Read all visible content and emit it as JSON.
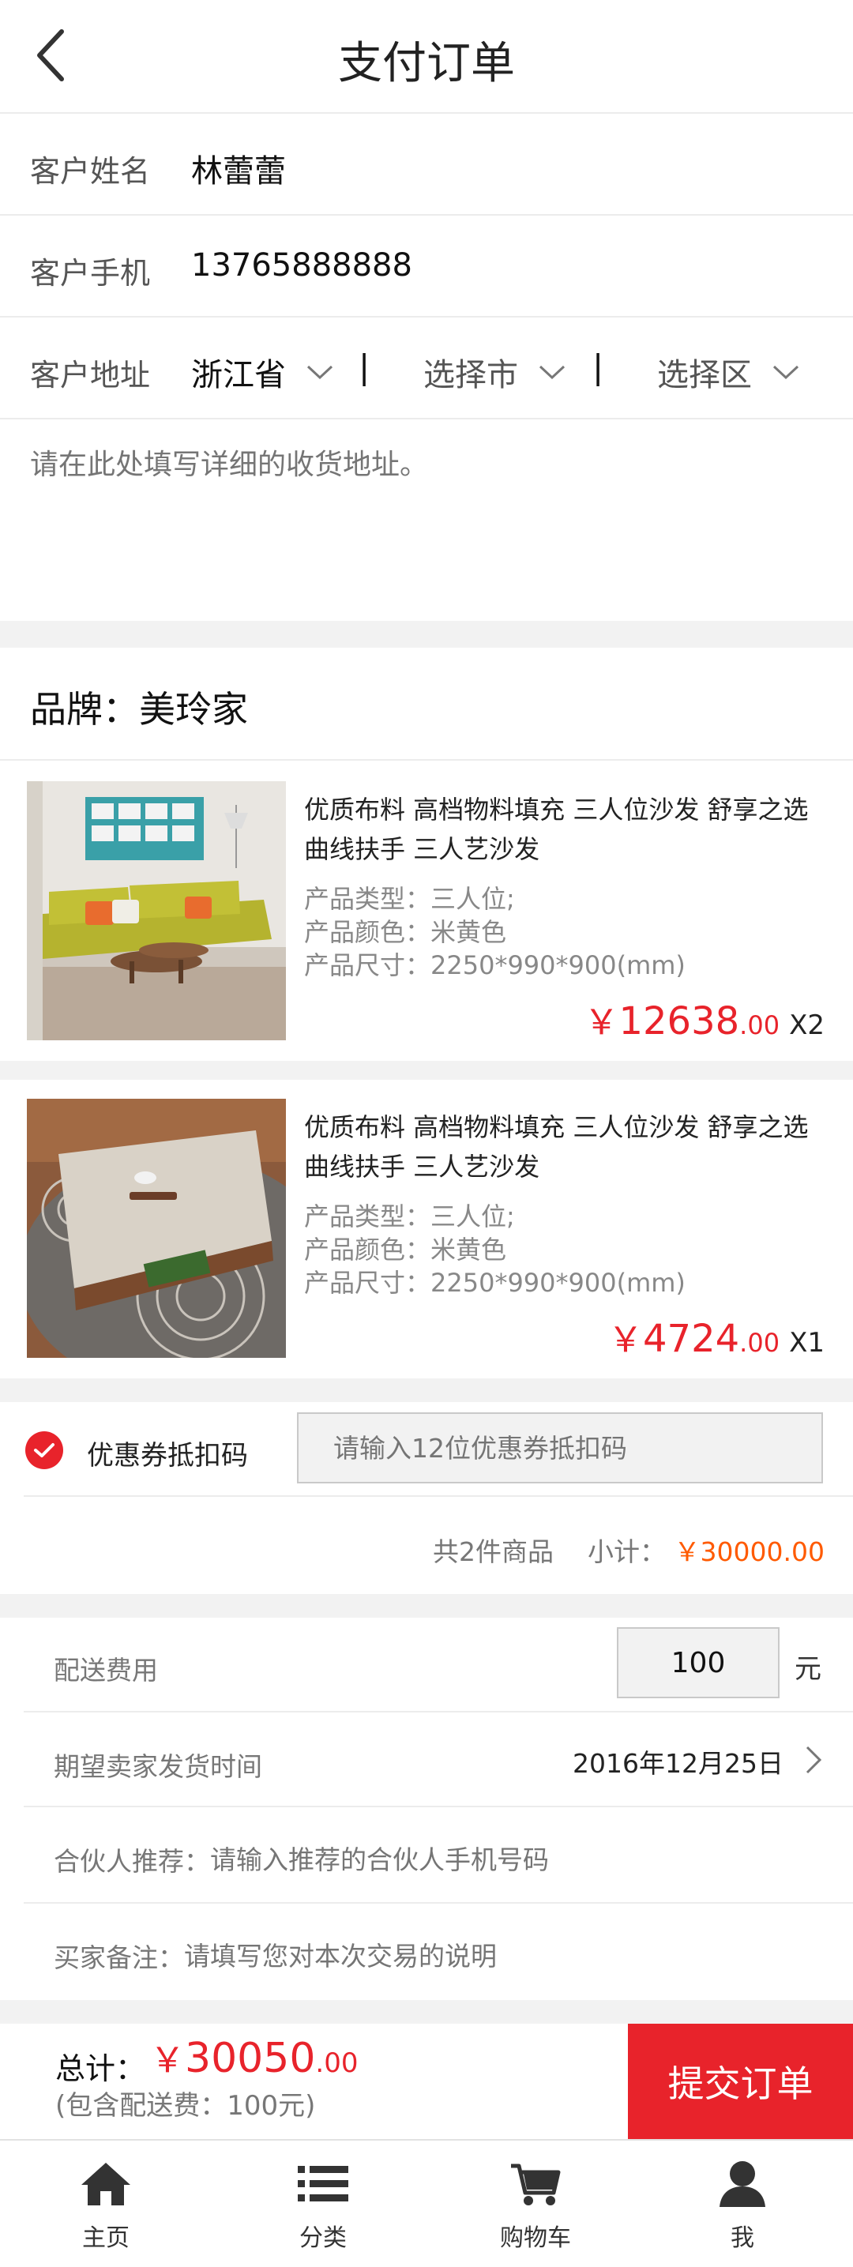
{
  "header": {
    "title": "支付订单"
  },
  "customer": {
    "name_label": "客户姓名",
    "name": "林蕾蕾",
    "phone_label": "客户手机",
    "phone": "13765888888",
    "address_label": "客户地址",
    "province": "浙江省",
    "city": "选择市",
    "district": "选择区",
    "separator": "|",
    "detail_placeholder": "请在此处填写详细的收货地址。"
  },
  "brand": {
    "label": "品牌：美玲家"
  },
  "products": [
    {
      "title_line1": "优质布料 高档物料填充 三人位沙发 舒享之选",
      "title_line2": "曲线扶手 三人艺沙发",
      "type": "产品类型：三人位;",
      "color": "产品颜色：米黄色",
      "size": "产品尺寸：2250*990*900(mm)",
      "currency": "￥",
      "price_int": "12638",
      "price_dec": ".00",
      "qty": "X2"
    },
    {
      "title_line1": "优质布料 高档物料填充 三人位沙发 舒享之选",
      "title_line2": "曲线扶手 三人艺沙发",
      "type": "产品类型：三人位;",
      "color": "产品颜色：米黄色",
      "size": "产品尺寸：2250*990*900(mm)",
      "currency": "￥",
      "price_int": "4724",
      "price_dec": ".00",
      "qty": "X1"
    }
  ],
  "coupon": {
    "label": "优惠券抵扣码",
    "placeholder": "请输入12位优惠券抵扣码",
    "checked": true
  },
  "summary": {
    "count_text": "共2件商品",
    "subtotal_label": "小计：",
    "subtotal_value": "￥30000.00"
  },
  "delivery": {
    "fee_label": "配送费用",
    "fee_value": "100",
    "fee_unit": "元",
    "ship_time_label": "期望卖家发货时间",
    "ship_time_value": "2016年12月25日",
    "partner_label": "合伙人推荐：",
    "partner_placeholder": "请输入推荐的合伙人手机号码",
    "note_label": "买家备注：",
    "note_placeholder": "请填写您对本次交易的说明"
  },
  "footer": {
    "total_label": "总计：",
    "currency": "￥",
    "total_int": "30050",
    "total_dec": ".00",
    "total_note": "(包含配送费：100元)",
    "submit_label": "提交订单"
  },
  "tabbar": [
    {
      "label": "主页",
      "icon": "home-icon"
    },
    {
      "label": "分类",
      "icon": "list-icon"
    },
    {
      "label": "购物车",
      "icon": "cart-icon"
    },
    {
      "label": "我",
      "icon": "user-icon"
    }
  ],
  "colors": {
    "accent": "#e8232b",
    "subtotal": "#ff5a00",
    "band": "#f2f2f2"
  }
}
